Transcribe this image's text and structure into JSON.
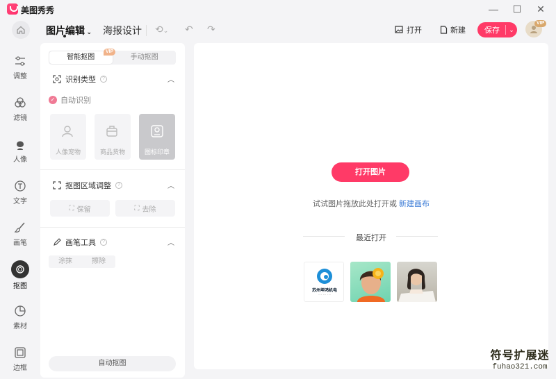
{
  "app": {
    "title": "美图秀秀"
  },
  "window": {
    "minimize": "—",
    "maximize": "☐",
    "close": "✕"
  },
  "toolbar": {
    "tabs": [
      {
        "label": "图片编辑",
        "active": true
      },
      {
        "label": "海报设计",
        "active": false
      }
    ],
    "open_label": "打开",
    "new_label": "新建",
    "save_label": "保存",
    "vip_badge": "VIP"
  },
  "rail": {
    "items": [
      {
        "label": "调整",
        "icon": "sliders-icon"
      },
      {
        "label": "滤镜",
        "icon": "filter-icon"
      },
      {
        "label": "人像",
        "icon": "portrait-icon"
      },
      {
        "label": "文字",
        "icon": "text-icon"
      },
      {
        "label": "画笔",
        "icon": "brush-icon"
      },
      {
        "label": "抠图",
        "icon": "cutout-icon",
        "active": true
      },
      {
        "label": "素材",
        "icon": "sticker-icon"
      },
      {
        "label": "边框",
        "icon": "frame-icon"
      }
    ]
  },
  "panel": {
    "modes": [
      {
        "label": "智能抠图",
        "active": true
      },
      {
        "label": "手动抠图"
      }
    ],
    "mode_vip": "VIP",
    "section1": {
      "title": "识别类型",
      "auto_detect": "自动识别"
    },
    "types": [
      {
        "label": "人像宠物"
      },
      {
        "label": "商品货物"
      },
      {
        "label": "图标印章",
        "selected": true
      }
    ],
    "section2": {
      "title": "抠图区域调整",
      "keep": "保留",
      "remove": "去除"
    },
    "section3": {
      "title": "画笔工具",
      "smear": "涂抹",
      "erase": "擦除"
    },
    "auto_cutout": "自动抠图"
  },
  "canvas": {
    "open_image": "打开图片",
    "hint_prefix": "试试图片拖放此处打开或",
    "hint_link": "新建画布",
    "recent_title": "最近打开",
    "recent": [
      {
        "name": "logo-thumb",
        "text": "苏州坤鸿机电",
        "sub": "··· ··· ···"
      },
      {
        "name": "orange-girl-thumb"
      },
      {
        "name": "reading-girl-thumb"
      }
    ]
  },
  "watermark": {
    "big": "符号扩展迷",
    "small": "fuhao321.com"
  },
  "colors": {
    "accent": "#ff3a67",
    "link": "#3b7bd6",
    "vip": "#d9a86c"
  }
}
